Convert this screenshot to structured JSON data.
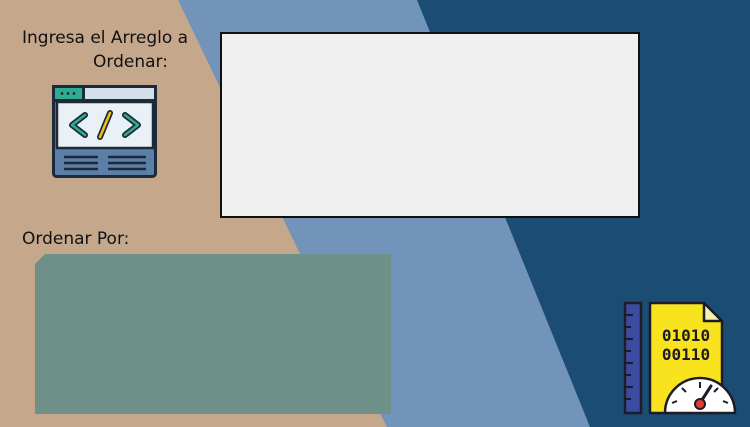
{
  "colors": {
    "tan": "#c5a88b",
    "light_blue": "#7294bb",
    "dark_blue": "#1b4d74",
    "input_bg": "#eff0ef",
    "order_panel": "#6e9088",
    "file_yellow": "#f9e31e",
    "ruler_blue": "#3c4ba2"
  },
  "labels": {
    "input_line1": "Ingresa el Arreglo a",
    "input_line2": "Ordenar:",
    "order_by": "Ordenar Por:"
  },
  "input": {
    "value": ""
  },
  "icons": {
    "code": "code-window-icon",
    "binary": "binary-file-speed-icon",
    "binary_text_1": "01010",
    "binary_text_2": "00110"
  }
}
